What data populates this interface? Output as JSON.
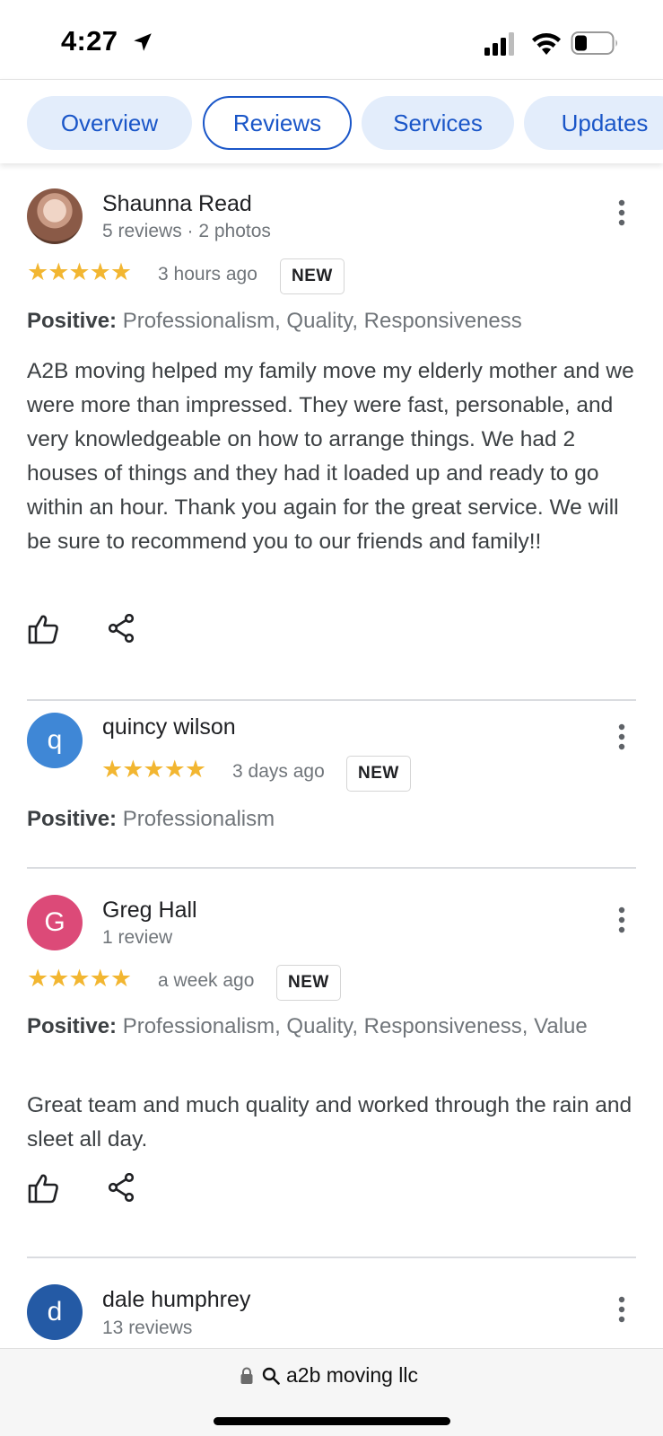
{
  "status_bar": {
    "time": "4:27",
    "icons": [
      "location-arrow-icon",
      "cellular-signal-icon",
      "wifi-icon",
      "battery-icon"
    ]
  },
  "tabs": [
    {
      "label": "Overview",
      "active": false
    },
    {
      "label": "Reviews",
      "active": true
    },
    {
      "label": "Services",
      "active": false
    },
    {
      "label": "Updates",
      "active": false
    }
  ],
  "reviews": [
    {
      "name": "Shaunna Read",
      "meta": "5 reviews · 2 photos",
      "avatar_letter": "",
      "rating": 5,
      "stars": "★★★★★",
      "time_ago": "3 hours ago",
      "badge": "NEW",
      "positive_label": "Positive:",
      "positive_values": "Professionalism, Quality, Responsiveness",
      "text": "A2B moving helped my family move my elderly mother and we were more than impressed. They were fast, personable, and very knowledgeable on how to arrange things. We had 2 houses of things and they had it loaded up and ready to go within an hour. Thank you again for the great service. We will be sure to recommend you to our friends and family!!"
    },
    {
      "name": "quincy wilson",
      "meta": "",
      "avatar_letter": "q",
      "avatar_color": "#3f87d6",
      "rating": 5,
      "stars": "★★★★★",
      "time_ago": "3 days ago",
      "badge": "NEW",
      "positive_label": "Positive:",
      "positive_values": "Professionalism",
      "text": ""
    },
    {
      "name": "Greg Hall",
      "meta": "1 review",
      "avatar_letter": "G",
      "avatar_color": "#dc4a78",
      "rating": 5,
      "stars": "★★★★★",
      "time_ago": "a week ago",
      "badge": "NEW",
      "positive_label": "Positive:",
      "positive_values": "Professionalism, Quality, Responsiveness, Value",
      "text": "Great team and much quality and worked through the rain and sleet all day."
    },
    {
      "name": "dale humphrey",
      "meta": "13 reviews",
      "avatar_letter": "d",
      "avatar_color": "#245aa5"
    }
  ],
  "bottom_bar": {
    "url_text": "a2b moving llc"
  },
  "colors": {
    "accent": "#1a56c8",
    "tab_bg": "#e3edfb",
    "star": "#f2b631"
  }
}
